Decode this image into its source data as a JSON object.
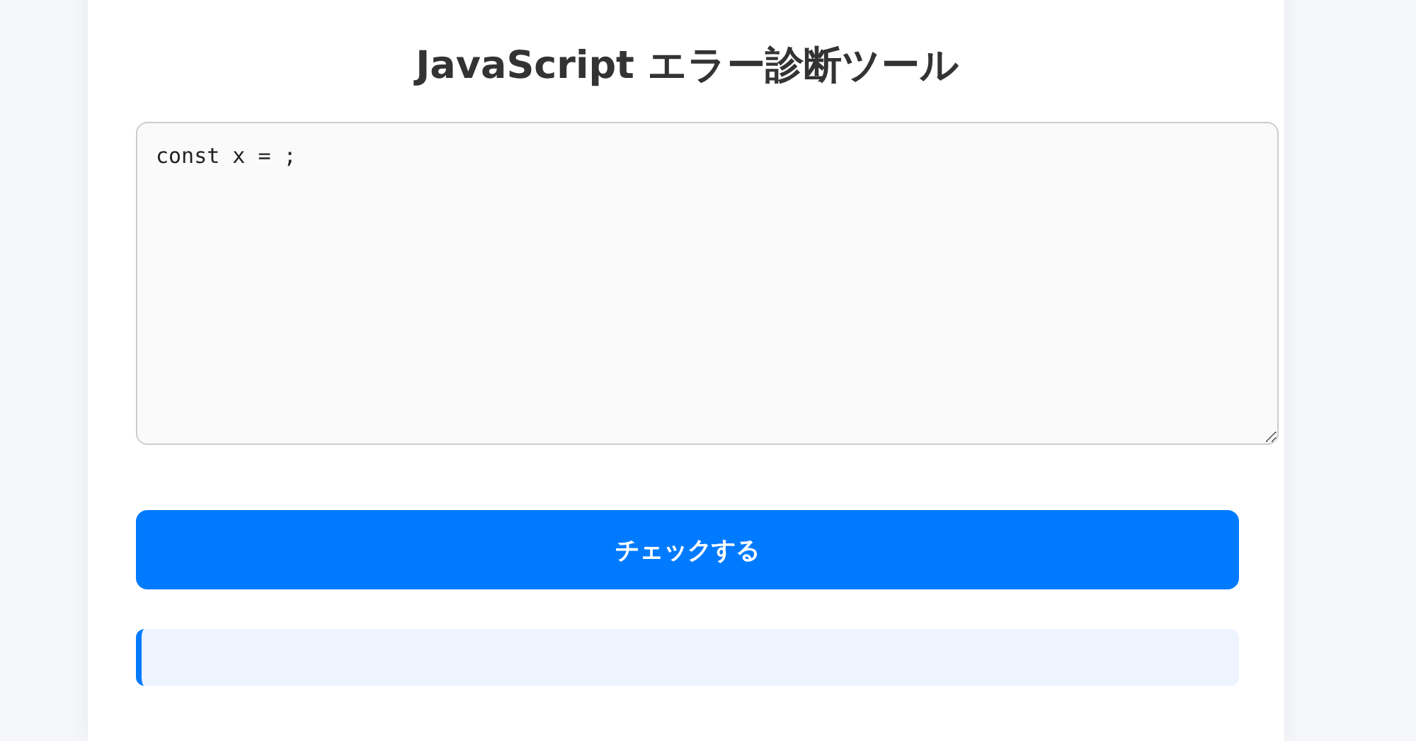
{
  "title": "JavaScript エラー診断ツール",
  "code_input": {
    "value": "const x = ;"
  },
  "check_button": {
    "label": "チェックする"
  }
}
